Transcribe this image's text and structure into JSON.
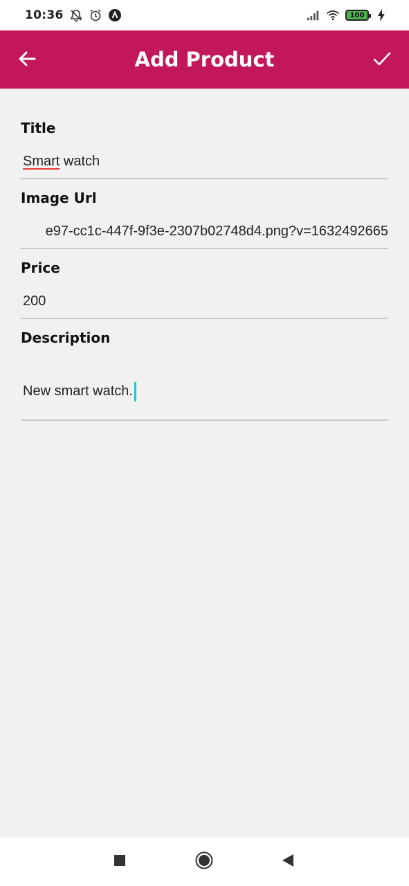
{
  "status_bar": {
    "time": "10:36",
    "battery": "100",
    "icons": [
      "notifications-off-icon",
      "alarm-icon",
      "app-logo-icon",
      "signal-icon",
      "wifi-icon",
      "battery-icon",
      "charging-icon"
    ]
  },
  "app_bar": {
    "title": "Add Product",
    "back_icon": "arrow-back-icon",
    "save_icon": "check-icon",
    "color": "#c2185b"
  },
  "form": {
    "title": {
      "label": "Title",
      "value_word1": "Smart",
      "value_rest": " watch"
    },
    "image_url": {
      "label": "Image Url",
      "value": "e97-cc1c-447f-9f3e-2307b02748d4.png?v=1632492665"
    },
    "price": {
      "label": "Price",
      "value": "200"
    },
    "description": {
      "label": "Description",
      "value": "New smart watch."
    }
  },
  "nav_bar": {
    "icons": [
      "recents-square-icon",
      "home-circle-icon",
      "back-triangle-icon"
    ]
  },
  "colors": {
    "accent": "#c2185b",
    "cursor": "#26c6c6",
    "spell_error": "#e53935",
    "background": "#f1f1f1"
  }
}
